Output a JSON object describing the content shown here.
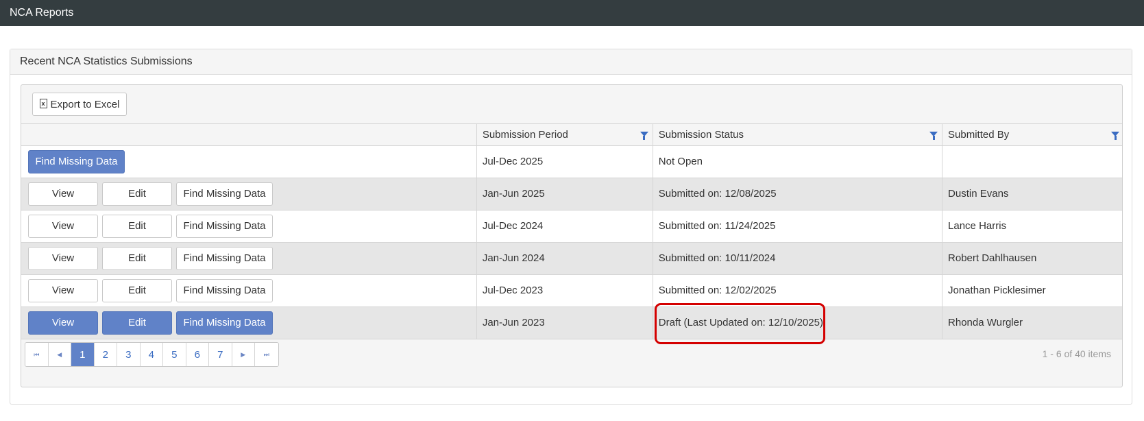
{
  "app": {
    "title": "NCA Reports"
  },
  "panel": {
    "title": "Recent NCA Statistics Submissions"
  },
  "toolbar": {
    "export_label": "Export to Excel",
    "export_icon": "excel-file-icon",
    "export_icon_glyph": "x"
  },
  "table": {
    "columns": [
      {
        "label": ""
      },
      {
        "label": "Submission Period",
        "filterable": true
      },
      {
        "label": "Submission Status",
        "filterable": true
      },
      {
        "label": "Submitted By",
        "filterable": true
      }
    ],
    "button_labels": {
      "view": "View",
      "edit": "Edit",
      "find_missing": "Find Missing Data"
    },
    "rows": [
      {
        "period": "Jul-Dec 2025",
        "status": "Not Open",
        "submitted_by": ""
      },
      {
        "period": "Jan-Jun 2025",
        "status": "Submitted on: 12/08/2025",
        "submitted_by": "Dustin Evans"
      },
      {
        "period": "Jul-Dec 2024",
        "status": "Submitted on: 11/24/2025",
        "submitted_by": "Lance Harris"
      },
      {
        "period": "Jan-Jun 2024",
        "status": "Submitted on: 10/11/2024",
        "submitted_by": "Robert Dahlhausen"
      },
      {
        "period": "Jul-Dec 2023",
        "status": "Submitted on: 12/02/2025",
        "submitted_by": "Jonathan Picklesimer"
      },
      {
        "period": "Jan-Jun 2023",
        "status": "Draft (Last Updated on: 12/10/2025)",
        "submitted_by": "Rhonda Wurgler"
      }
    ]
  },
  "pager": {
    "first": "⏮",
    "prev": "◀",
    "next": "▶",
    "last": "⏭",
    "pages": [
      "1",
      "2",
      "3",
      "4",
      "5",
      "6",
      "7"
    ],
    "current": "1",
    "info": "1 - 6 of 40 items"
  },
  "colors": {
    "topbar": "#343d40",
    "primary": "#6082c8",
    "highlight": "#d40000",
    "link": "#3a6cc2"
  }
}
